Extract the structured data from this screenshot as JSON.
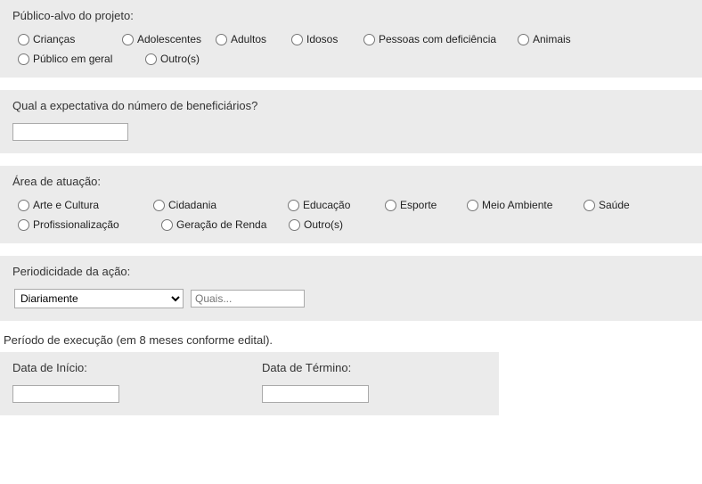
{
  "publicoAlvo": {
    "title": "Público-alvo do projeto:",
    "options": [
      "Crianças",
      "Adolescentes",
      "Adultos",
      "Idosos",
      "Pessoas com deficiência",
      "Animais",
      "Público em geral",
      "Outro(s)"
    ]
  },
  "expectativa": {
    "title": "Qual a expectativa do número de beneficiários?",
    "value": ""
  },
  "areaAtuacao": {
    "title": "Área de atuação:",
    "options": [
      "Arte e Cultura",
      "Cidadania",
      "Educação",
      "Esporte",
      "Meio Ambiente",
      "Saúde",
      "Profissionalização",
      "Geração de Renda",
      "Outro(s)"
    ]
  },
  "periodicidade": {
    "title": "Periodicidade da ação:",
    "selectValue": "Diariamente",
    "quaisPlaceholder": "Quais...",
    "quaisValue": ""
  },
  "periodoExecucao": {
    "title": "Período de execução (em 8 meses conforme edital).",
    "inicioLabel": "Data de Início:",
    "inicioValue": "",
    "terminoLabel": "Data de Término:",
    "terminoValue": ""
  }
}
